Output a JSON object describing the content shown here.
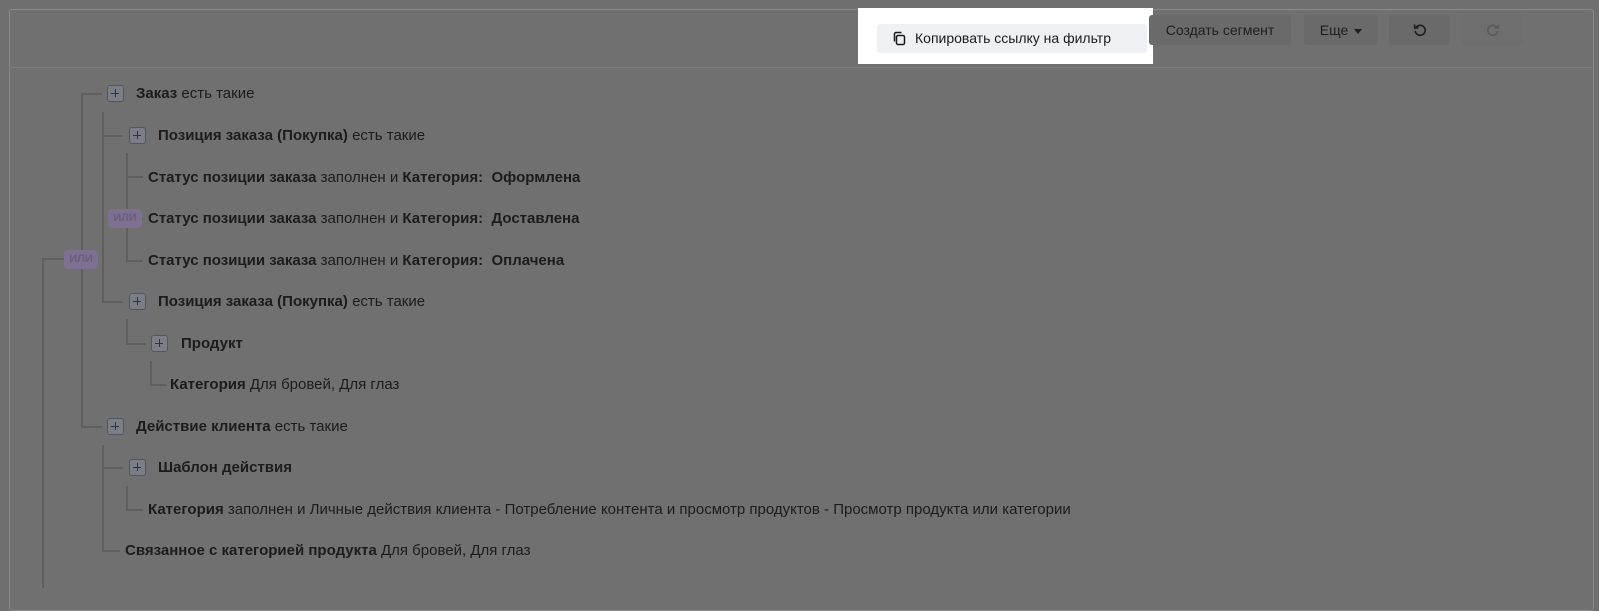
{
  "toolbar": {
    "copy_link_label": "Копировать ссылку на фильтр",
    "create_segment_label": "Создать сегмент",
    "more_label": "Еще",
    "undo_icon": "undo-icon",
    "redo_icon": "redo-icon",
    "copy_icon": "copy-icon"
  },
  "colors": {
    "overlay": "#6f6f6f",
    "highlight": "#ffffff",
    "copy_button": "#eef0f4",
    "or_badge": "#7d7090"
  },
  "badges": {
    "or_label": "ИЛИ"
  },
  "tree": {
    "order": {
      "title": "Заказ",
      "condition": "есть такие"
    },
    "item1": {
      "title": "Позиция заказа (Покупка)",
      "condition": "есть такие"
    },
    "status1": {
      "field": "Статус позиции заказа",
      "mid": "заполнен и",
      "cat_label": "Категория:",
      "value": "Оформлена"
    },
    "status2": {
      "field": "Статус позиции заказа",
      "mid": "заполнен и",
      "cat_label": "Категория:",
      "value": "Доставлена"
    },
    "status3": {
      "field": "Статус позиции заказа",
      "mid": "заполнен и",
      "cat_label": "Категория:",
      "value": "Оплачена"
    },
    "item2": {
      "title": "Позиция заказа (Покупка)",
      "condition": "есть такие"
    },
    "product": {
      "title": "Продукт"
    },
    "product_category": {
      "field": "Категория",
      "value": "Для бровей, Для глаз"
    },
    "action": {
      "title": "Действие клиента",
      "condition": "есть такие"
    },
    "template": {
      "title": "Шаблон действия"
    },
    "action_category": {
      "field": "Категория",
      "value": "заполнен и Личные действия клиента - Потребление контента и просмотр продуктов - Просмотр продукта или категории"
    },
    "related": {
      "field": "Связанное с категорией продукта",
      "value": "Для бровей, Для глаз"
    }
  }
}
